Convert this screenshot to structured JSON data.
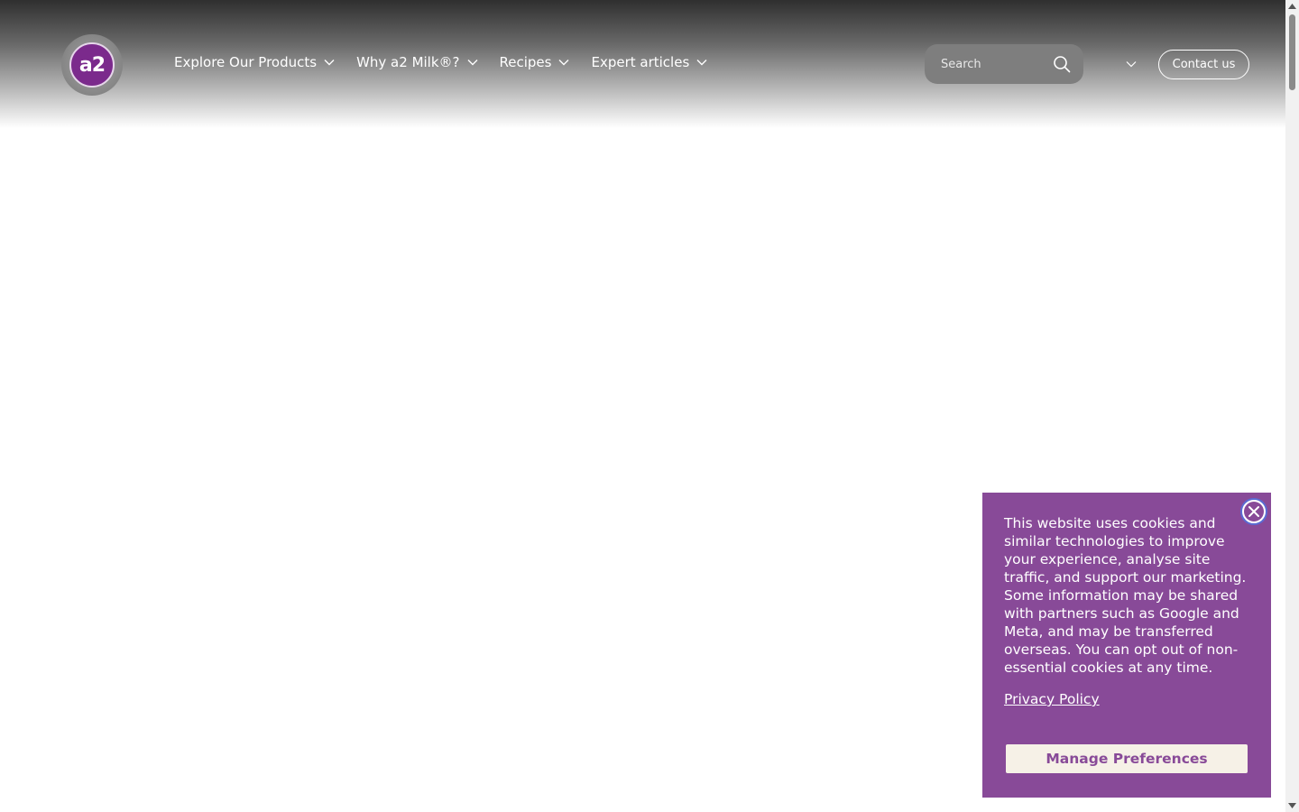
{
  "brand": {
    "logo_icon": "a2-milk-logo",
    "logo_text": "a2",
    "accent_color": "#884a98"
  },
  "nav": {
    "items": [
      {
        "label": "Explore Our Products"
      },
      {
        "label": "Why a2 Milk®?"
      },
      {
        "label": "Recipes"
      },
      {
        "label": "Expert articles"
      }
    ]
  },
  "search": {
    "placeholder": "Search"
  },
  "header": {
    "contact_label": "Contact us"
  },
  "cookie": {
    "message": "This website uses cookies and similar technologies to improve your experience, analyse site traffic, and support our marketing. Some information may be shared with partners such as Google and Meta, and may be transferred overseas. You can opt out of non-essential cookies at any time.",
    "privacy_link": "Privacy Policy",
    "manage_label": "Manage Preferences",
    "background_color": "#884a98"
  }
}
